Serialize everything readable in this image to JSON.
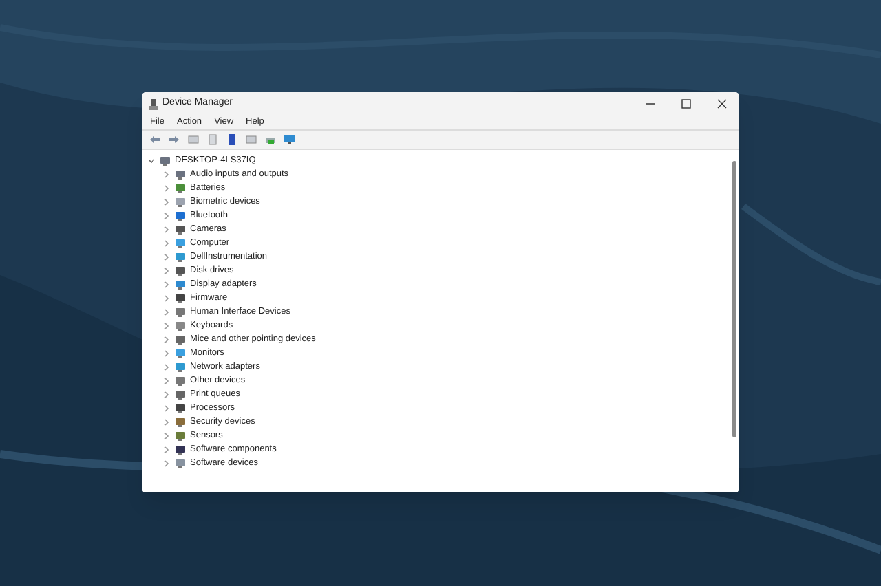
{
  "window": {
    "title": "Device Manager"
  },
  "menu": [
    "File",
    "Action",
    "View",
    "Help"
  ],
  "tree": {
    "label": "DESKTOP-4LS37IQ",
    "expanded": true,
    "children": [
      {
        "label": "Audio inputs and outputs",
        "expanded": false
      },
      {
        "label": "Batteries",
        "expanded": false
      },
      {
        "label": "Biometric devices",
        "expanded": false
      },
      {
        "label": "Bluetooth",
        "expanded": false
      },
      {
        "label": "Cameras",
        "expanded": false
      },
      {
        "label": "Computer",
        "expanded": false
      },
      {
        "label": "DellInstrumentation",
        "expanded": false
      },
      {
        "label": "Disk drives",
        "expanded": false
      },
      {
        "label": "Display adapters",
        "expanded": false
      },
      {
        "label": "Firmware",
        "expanded": false
      },
      {
        "label": "Human Interface Devices",
        "expanded": false
      },
      {
        "label": "Keyboards",
        "expanded": false
      },
      {
        "label": "Mice and other pointing devices",
        "expanded": false
      },
      {
        "label": "Monitors",
        "expanded": false
      },
      {
        "label": "Network adapters",
        "expanded": false
      },
      {
        "label": "Other devices",
        "expanded": false
      },
      {
        "label": "Print queues",
        "expanded": false
      },
      {
        "label": "Processors",
        "expanded": false
      },
      {
        "label": "Security devices",
        "expanded": false
      },
      {
        "label": "Sensors",
        "expanded": false
      },
      {
        "label": "Software components",
        "expanded": false
      },
      {
        "label": "Software devices",
        "expanded": false
      }
    ]
  }
}
